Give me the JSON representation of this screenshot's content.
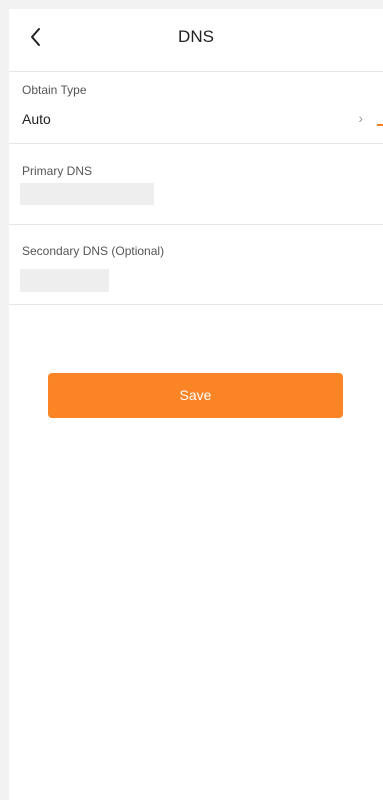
{
  "header": {
    "title": "DNS",
    "back_icon": "chevron-left-icon"
  },
  "obtain_type": {
    "label": "Obtain Type",
    "value": "Auto",
    "chevron_icon": "chevron-right-icon"
  },
  "primary_dns": {
    "label": "Primary DNS",
    "value": ""
  },
  "secondary_dns": {
    "label": "Secondary DNS (Optional)",
    "value": ""
  },
  "actions": {
    "save_label": "Save"
  },
  "colors": {
    "accent": "#fb8424",
    "input_bg": "#eeeeee",
    "divider": "#e6e6e6"
  }
}
